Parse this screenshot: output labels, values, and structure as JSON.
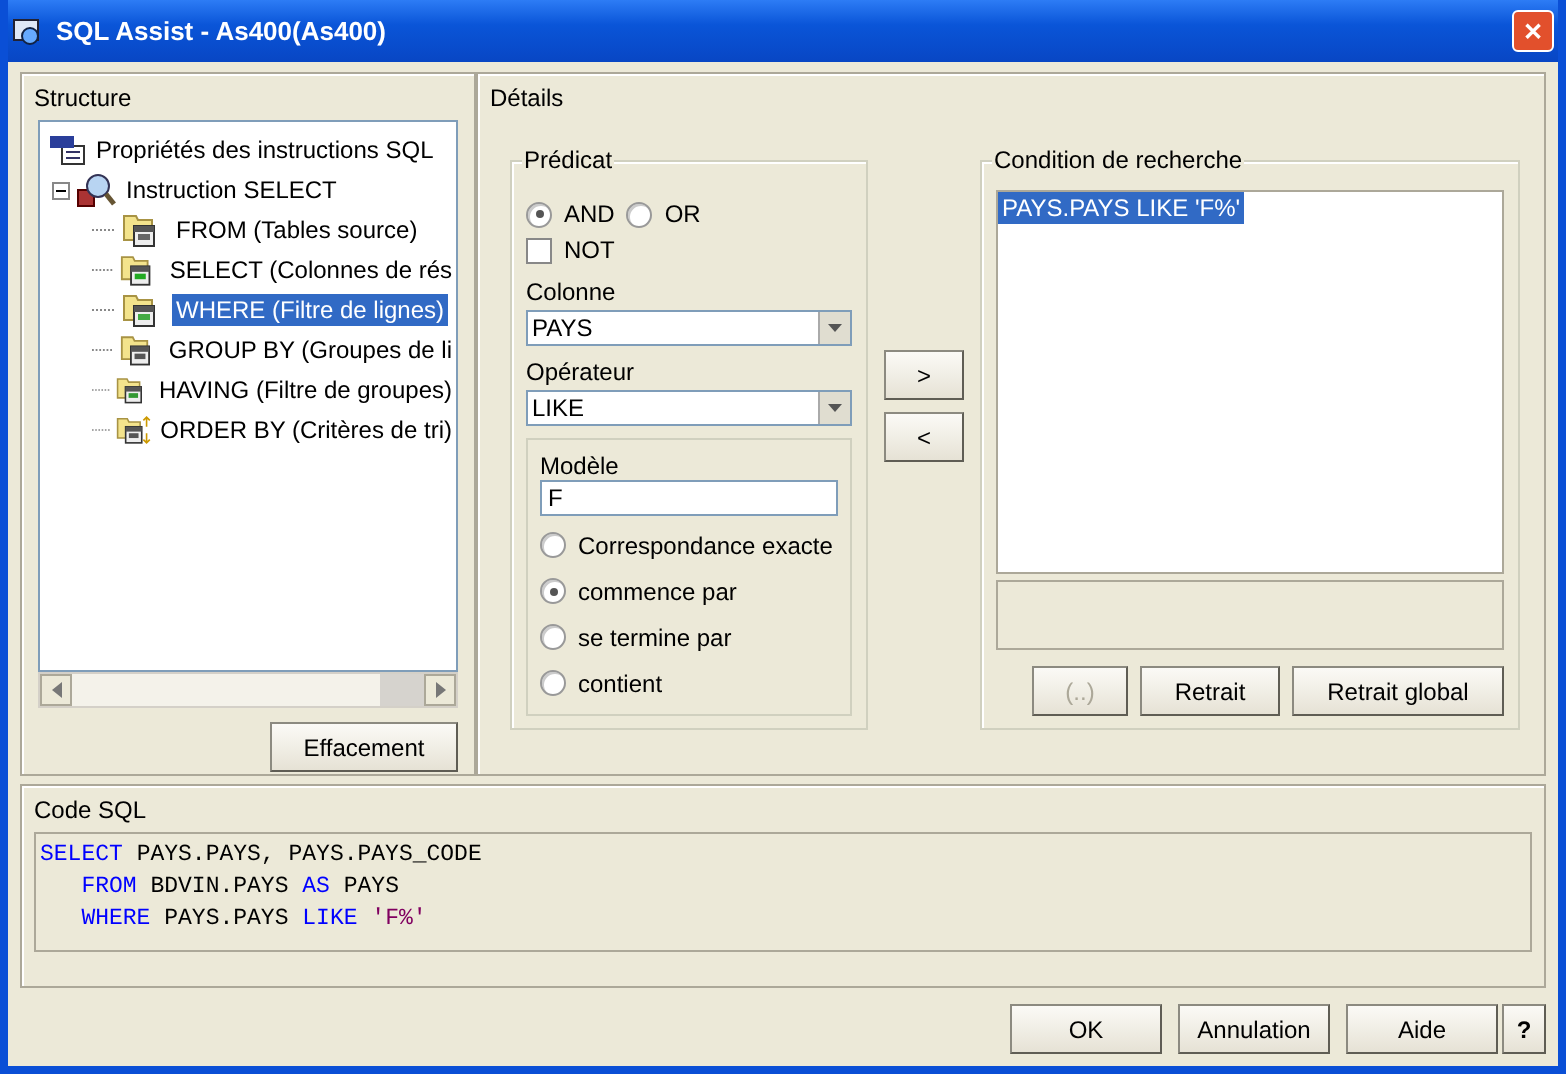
{
  "window": {
    "title": "SQL Assist - As400(As400)",
    "close": "✕"
  },
  "structure": {
    "title": "Structure",
    "tree": [
      {
        "label": "Propriétés des instructions SQL",
        "kind": "sql",
        "selected": false,
        "children": [
          {
            "label": "Instruction SELECT",
            "kind": "query",
            "selected": false,
            "expanded": true,
            "children": [
              {
                "label": "FROM (Tables source)",
                "kind": "table",
                "selected": false
              },
              {
                "label": "SELECT (Colonnes de rés",
                "kind": "columns",
                "selected": false
              },
              {
                "label": "WHERE (Filtre de lignes)",
                "kind": "filter",
                "selected": true
              },
              {
                "label": "GROUP BY (Groupes de li",
                "kind": "group",
                "selected": false
              },
              {
                "label": "HAVING (Filtre de groupes)",
                "kind": "group-filter",
                "selected": false
              },
              {
                "label": "ORDER BY (Critères de tri)",
                "kind": "order",
                "selected": false
              }
            ]
          }
        ]
      }
    ],
    "clear_button": "Effacement"
  },
  "details": {
    "title": "Détails",
    "predicate": {
      "title": "Prédicat",
      "logic": [
        {
          "label": "AND",
          "selected": true
        },
        {
          "label": "OR",
          "selected": false
        }
      ],
      "not": {
        "label": "NOT",
        "checked": false
      },
      "column": {
        "label": "Colonne",
        "value": "PAYS"
      },
      "operator": {
        "label": "Opérateur",
        "value": "LIKE"
      },
      "pattern": {
        "label": "Modèle",
        "value": "F",
        "match": [
          {
            "label": "Correspondance exacte",
            "selected": false
          },
          {
            "label": "commence par",
            "selected": true
          },
          {
            "label": "se termine par",
            "selected": false
          },
          {
            "label": "contient",
            "selected": false
          }
        ]
      }
    },
    "move_buttons": [
      ">",
      "<"
    ],
    "condition": {
      "title": "Condition de recherche",
      "items": [
        {
          "text": "PAYS.PAYS LIKE 'F%'",
          "selected": true
        }
      ],
      "buttons": [
        {
          "label": "(..)",
          "disabled": true
        },
        {
          "label": "Retrait",
          "disabled": false
        },
        {
          "label": "Retrait global",
          "disabled": false
        }
      ]
    }
  },
  "sql_code": {
    "title": "Code SQL",
    "lines": [
      {
        "indented": false,
        "tokens": [
          {
            "kind": "keyword",
            "text": "SELECT"
          },
          {
            "kind": "plain",
            "text": "PAYS.PAYS, PAYS.PAYS_CODE"
          }
        ]
      },
      {
        "indented": true,
        "tokens": [
          {
            "kind": "keyword",
            "text": "FROM"
          },
          {
            "kind": "plain",
            "text": "BDVIN.PAYS"
          },
          {
            "kind": "keyword",
            "text": "AS"
          },
          {
            "kind": "plain",
            "text": "PAYS"
          }
        ]
      },
      {
        "indented": true,
        "tokens": [
          {
            "kind": "keyword",
            "text": "WHERE"
          },
          {
            "kind": "plain",
            "text": "PAYS.PAYS"
          },
          {
            "kind": "keyword",
            "text": "LIKE"
          },
          {
            "kind": "string",
            "text": "'F%'"
          }
        ]
      }
    ]
  },
  "buttons": [
    "OK",
    "Annulation",
    "Aide",
    "?"
  ]
}
